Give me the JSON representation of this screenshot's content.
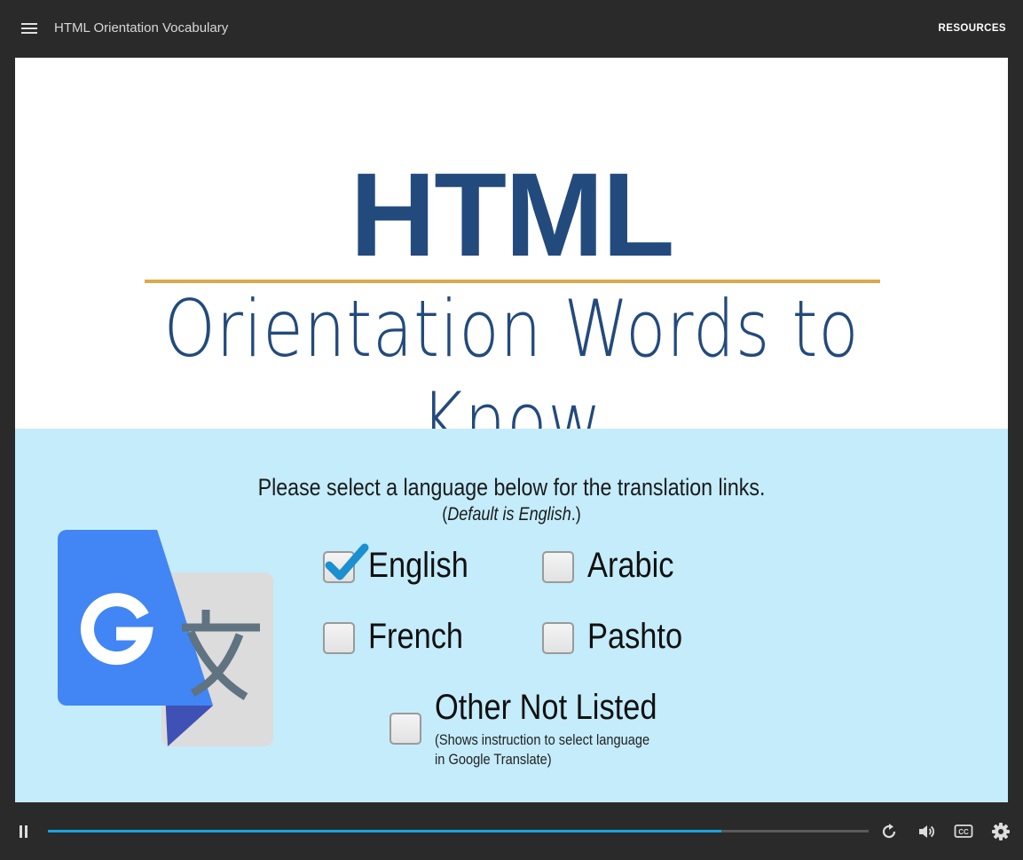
{
  "header": {
    "title": "HTML Orientation Vocabulary",
    "resources_label": "RESOURCES"
  },
  "slide": {
    "heading": "HTML",
    "subtitle": "Orientation Words to Know",
    "prompt": "Please select a language below for the translation links.",
    "prompt_note_open": "(",
    "prompt_note_italic": "Default is English",
    "prompt_note_close": ".)",
    "options": {
      "english": {
        "label": "English",
        "checked": true
      },
      "arabic": {
        "label": "Arabic",
        "checked": false
      },
      "french": {
        "label": "French",
        "checked": false
      },
      "pashto": {
        "label": "Pashto",
        "checked": false
      },
      "other": {
        "label": "Other Not Listed",
        "checked": false,
        "note_line1": "(Shows instruction to select language",
        "note_line2": "in Google Translate)"
      }
    },
    "logo_icon": "google-translate-icon",
    "colors": {
      "heading": "#234a7c",
      "rule": "#dba94a",
      "panel_background": "#c4ecfb",
      "checkmark": "#1b8fd0"
    }
  },
  "player": {
    "progress": 0.82,
    "icons": [
      "pause-icon",
      "replay-icon",
      "volume-icon",
      "closed-captions-icon",
      "settings-icon"
    ],
    "accent_color": "#1aa3df"
  }
}
